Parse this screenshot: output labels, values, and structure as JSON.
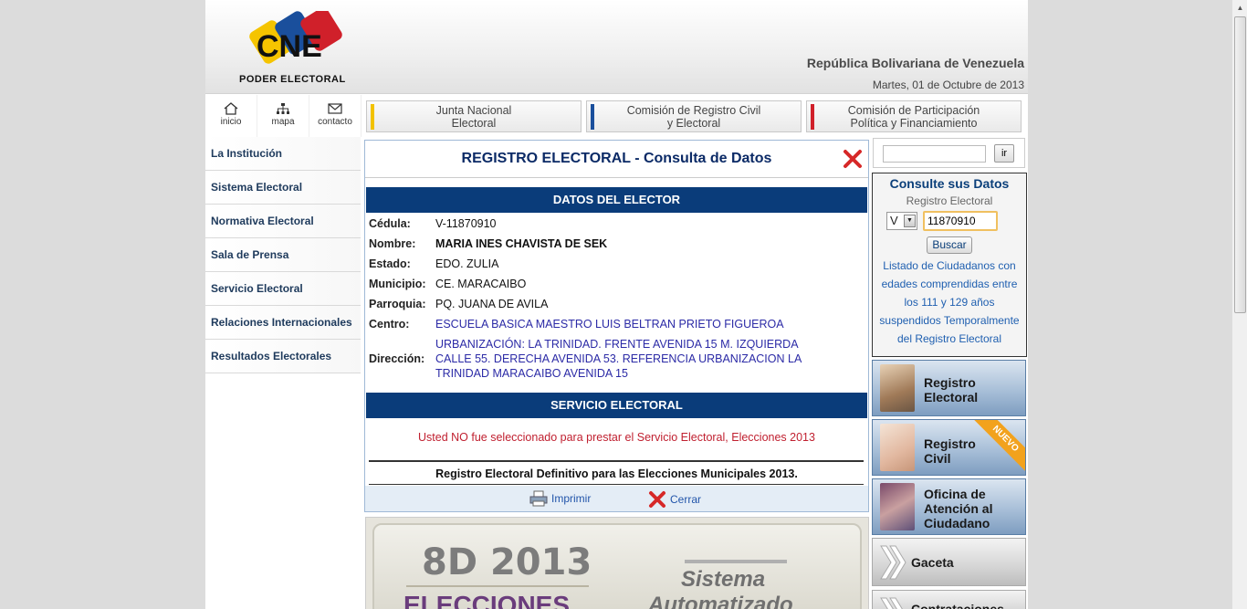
{
  "header": {
    "logo_text": "PODER ELECTORAL",
    "country": "República Bolivariana de Venezuela",
    "date": "Martes, 01 de Octubre de 2013"
  },
  "utility_nav": [
    {
      "label": "inicio",
      "icon": "home-icon"
    },
    {
      "label": "mapa",
      "icon": "sitemap-icon"
    },
    {
      "label": "contacto",
      "icon": "envelope-icon"
    }
  ],
  "top_nav": [
    {
      "line1": "Junta Nacional",
      "line2": "Electoral",
      "color": "#f2c200"
    },
    {
      "line1": "Comisión de Registro Civil",
      "line2": "y Electoral",
      "color": "#1a4f9c"
    },
    {
      "line1": "Comisión de Participación",
      "line2": "Política y Financiamiento",
      "color": "#d0202a"
    }
  ],
  "sidebar": {
    "items": [
      {
        "label": "La Institución"
      },
      {
        "label": "Sistema Electoral"
      },
      {
        "label": "Normativa Electoral"
      },
      {
        "label": "Sala de Prensa"
      },
      {
        "label": "Servicio Electoral"
      },
      {
        "label": "Relaciones Internacionales"
      },
      {
        "label": "Resultados Electorales"
      }
    ]
  },
  "main": {
    "title": "REGISTRO ELECTORAL - Consulta de Datos",
    "datos_header": "DATOS DEL ELECTOR",
    "fields": [
      {
        "label": "Cédula:",
        "value": "V-11870910"
      },
      {
        "label": "Nombre:",
        "value": "MARIA INES CHAVISTA DE SEK"
      },
      {
        "label": "Estado:",
        "value": "EDO. ZULIA"
      },
      {
        "label": "Municipio:",
        "value": "CE. MARACAIBO"
      },
      {
        "label": "Parroquia:",
        "value": "PQ. JUANA DE AVILA"
      },
      {
        "label": "Centro:",
        "value": "ESCUELA BASICA MAESTRO LUIS BELTRAN PRIETO FIGUEROA"
      },
      {
        "label": "Dirección:",
        "value": "URBANIZACIÓN: LA TRINIDAD. FRENTE AVENIDA 15 M. IZQUIERDA CALLE 55. DERECHA AVENIDA 53. REFERENCIA URBANIZACION LA TRINIDAD MARACAIBO AVENIDA 15"
      }
    ],
    "servicio_header": "SERVICIO ELECTORAL",
    "servicio_notice": "Usted NO fue seleccionado para prestar el Servicio Electoral, Elecciones 2013",
    "definitivo": "Registro Electoral Definitivo para las Elecciones Municipales 2013.",
    "print_label": "Imprimir",
    "close_label": "Cerrar"
  },
  "banner": {
    "year": "8D 2013",
    "elecciones": "ELECCIONES",
    "sistema": "Sistema",
    "automatizado": "Automatizado"
  },
  "search": {
    "value": "",
    "button": "ir"
  },
  "consulta": {
    "title": "Consulte sus Datos",
    "subtitle": "Registro Electoral",
    "nationality": "V",
    "cedula": "11870910",
    "button": "Buscar",
    "listado": "Listado de Ciudadanos con edades comprendidas entre los 111 y 129 años suspendidos Temporalmente del Registro Electoral"
  },
  "right_buttons": {
    "registro_electoral": [
      "Registro",
      "Electoral"
    ],
    "registro_civil": [
      "Registro",
      "Civil"
    ],
    "nuevo_badge": "NUEVO",
    "oficina": [
      "Oficina de",
      "Atención al",
      "Ciudadano"
    ],
    "gaceta": "Gaceta",
    "contrataciones": "Contrataciones"
  }
}
